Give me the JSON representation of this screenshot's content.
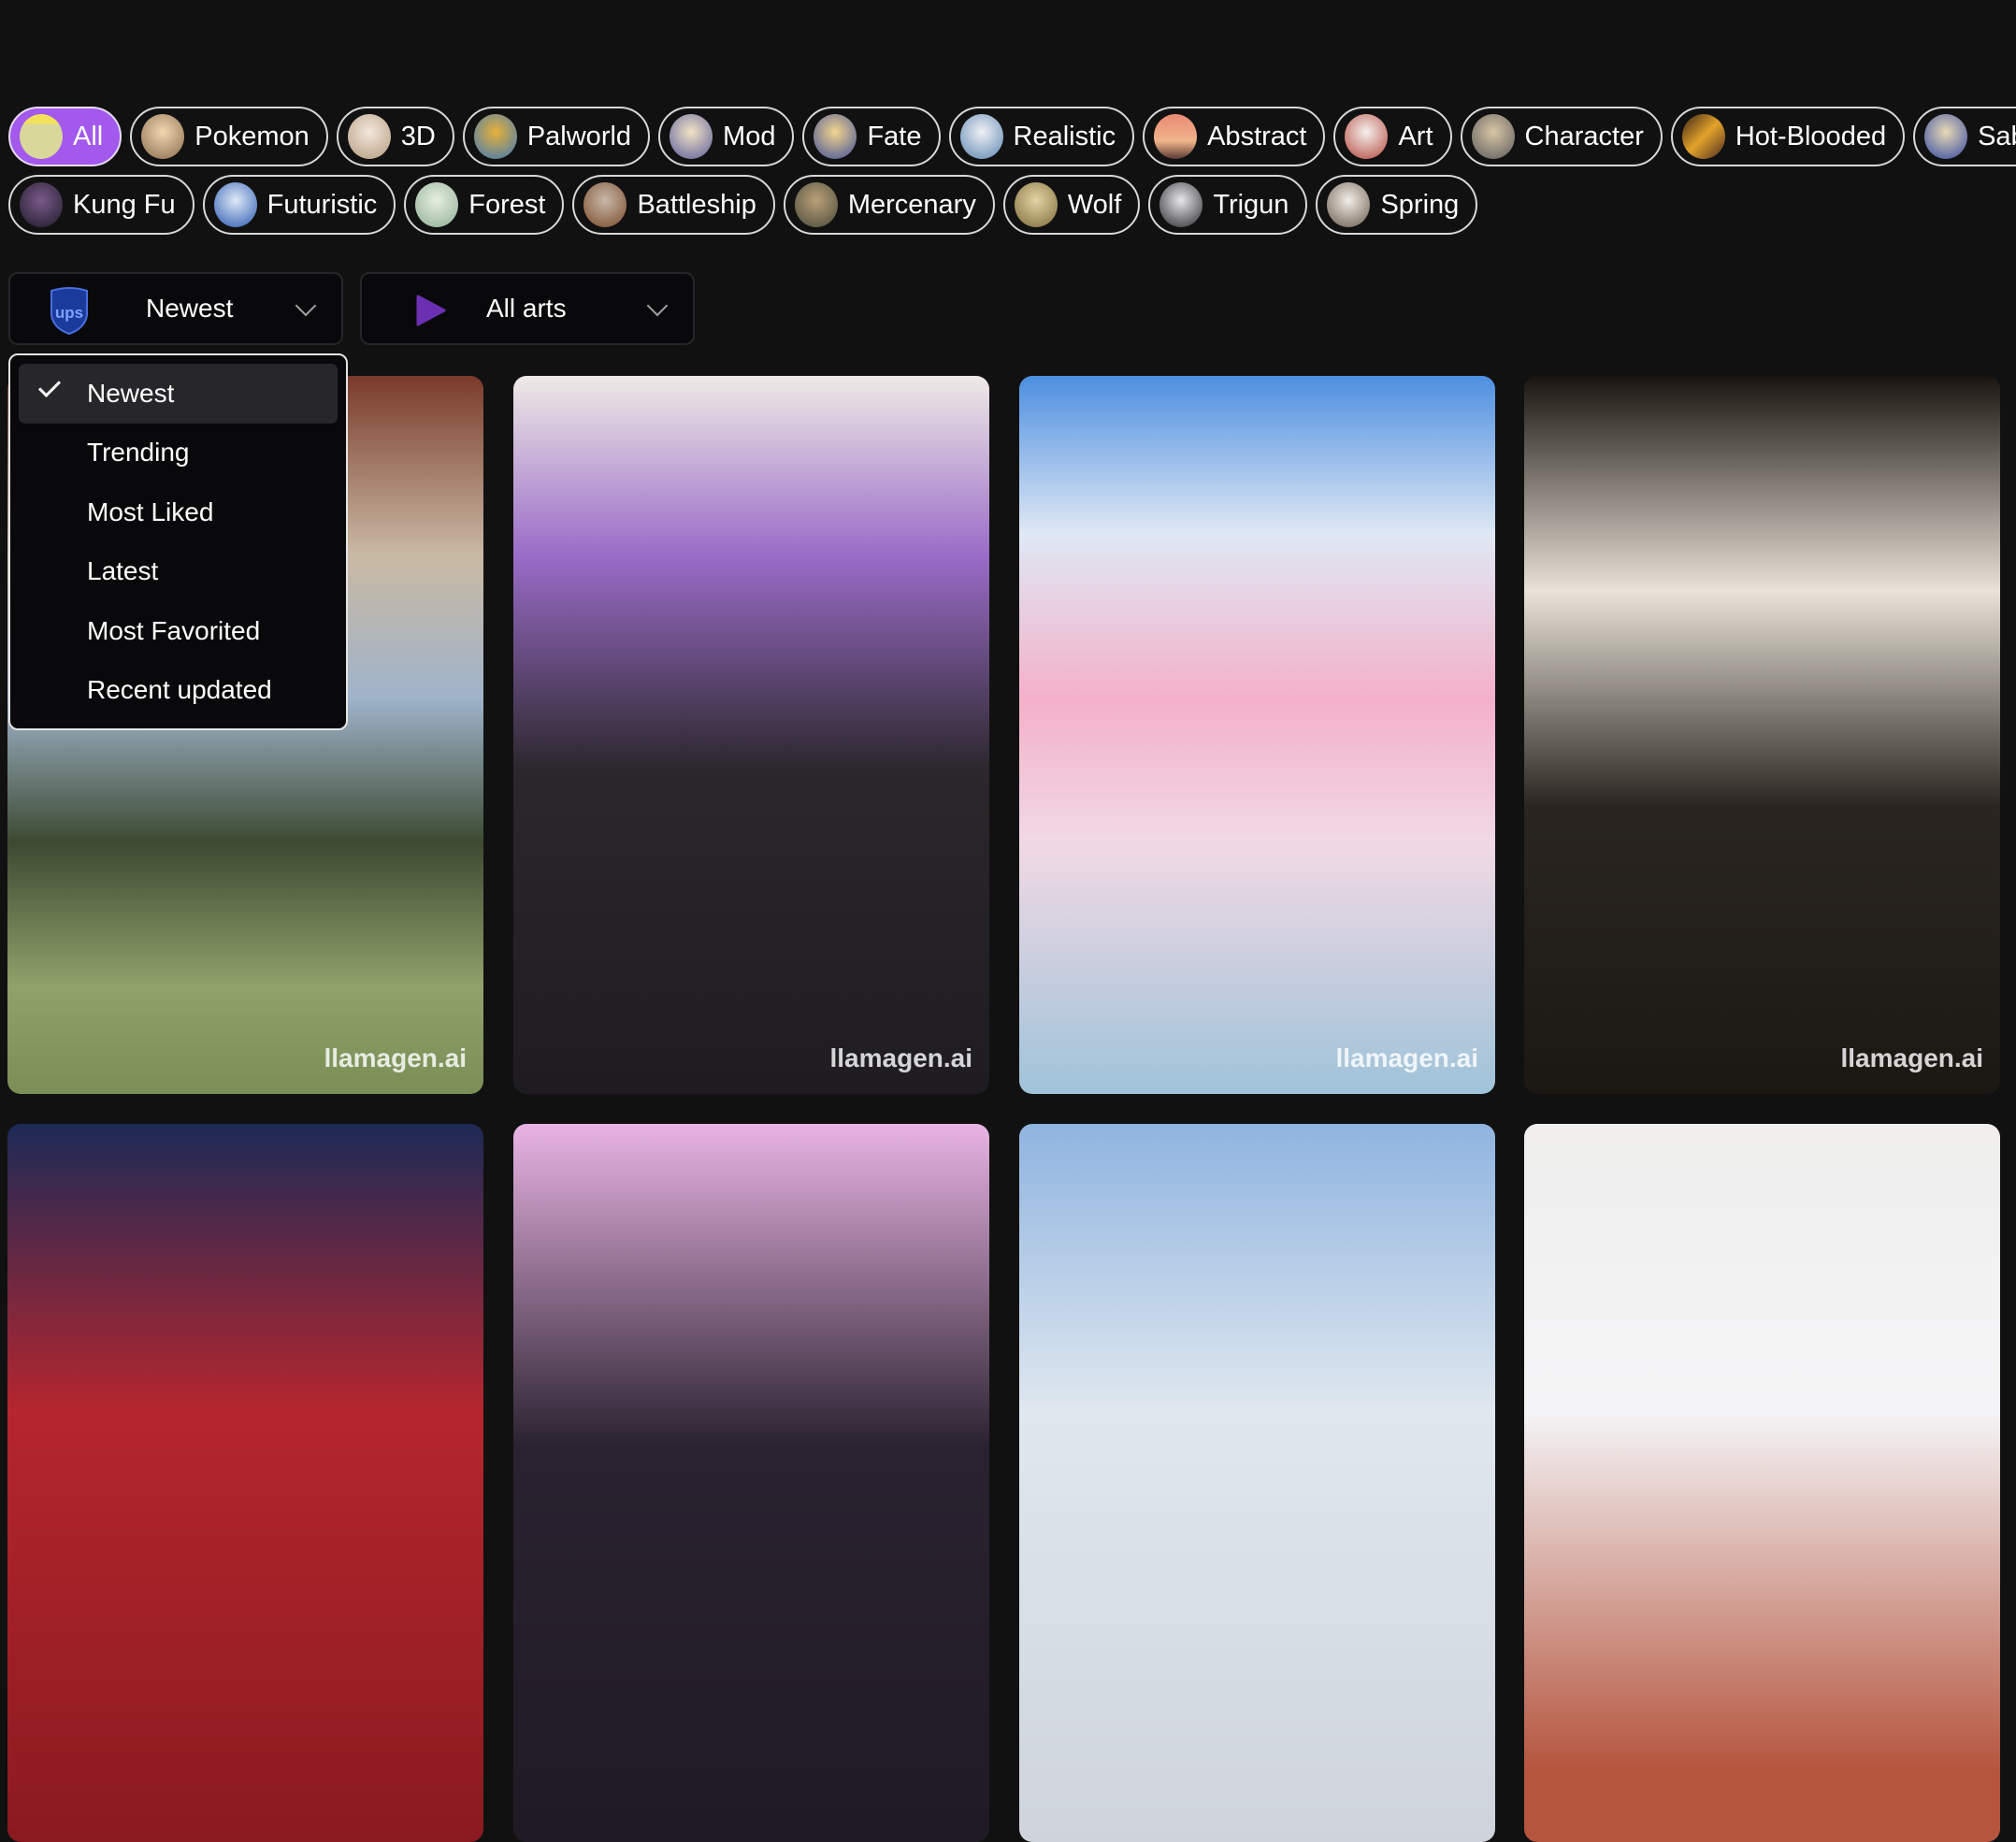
{
  "categories": {
    "row1": [
      {
        "label": "All",
        "active": true,
        "thumb": "linear-gradient(#f2e15a 0 22%, #d9d79a 22% 100%)"
      },
      {
        "label": "Pokemon",
        "thumb": "radial-gradient(circle at 50% 40%, #f1d8b0, #8a6b4f)"
      },
      {
        "label": "3D",
        "thumb": "radial-gradient(circle at 50% 40%, #f3e8dc, #b49a7e)"
      },
      {
        "label": "Palworld",
        "thumb": "radial-gradient(circle at 50% 40%, #e7b23a, #3b76b8)"
      },
      {
        "label": "Mod",
        "thumb": "radial-gradient(circle at 50% 40%, #f2e3c6, #5a5d9a)"
      },
      {
        "label": "Fate",
        "thumb": "radial-gradient(circle at 50% 40%, #f3d58d, #3f4f9a)"
      },
      {
        "label": "Realistic",
        "thumb": "radial-gradient(circle at 50% 40%, #f0f0f4, #5c86b2)"
      },
      {
        "label": "Abstract",
        "thumb": "linear-gradient(#e88a72, #f0b48c 60%, #5a3a32)"
      },
      {
        "label": "Art",
        "thumb": "radial-gradient(circle at 50% 40%, #f4f0ee, #b4483c)"
      },
      {
        "label": "Character",
        "thumb": "radial-gradient(circle at 50% 40%, #d9c6a6, #5a5a5a)"
      },
      {
        "label": "Hot-Blooded",
        "thumb": "linear-gradient(135deg,#3b2418,#e4a32a 50%,#4a2a20)"
      },
      {
        "label": "Saber",
        "thumb": "radial-gradient(circle at 50% 40%, #e9d9b6, #3148a0)"
      }
    ],
    "row2": [
      {
        "label": "Kung Fu",
        "thumb": "radial-gradient(circle at 50% 40%, #7a5a8a, #1e1a28)"
      },
      {
        "label": "Futuristic",
        "thumb": "radial-gradient(circle at 50% 40%, #dfe9f7, #2a58b0)"
      },
      {
        "label": "Forest",
        "thumb": "radial-gradient(circle at 50% 40%, #e6efe0, #8fae94)"
      },
      {
        "label": "Battleship",
        "thumb": "radial-gradient(circle at 50% 40%, #c8b8a8, #7a4a2a)"
      },
      {
        "label": "Mercenary",
        "thumb": "radial-gradient(circle at 50% 40%, #b9a07a, #4a4a3a)"
      },
      {
        "label": "Wolf",
        "thumb": "radial-gradient(circle at 50% 40%, #e4d3a4, #7c6a3a)"
      },
      {
        "label": "Trigun",
        "thumb": "radial-gradient(circle at 50% 40%, #e8e8ea, #2a2a2e)"
      },
      {
        "label": "Spring",
        "thumb": "radial-gradient(circle at 50% 40%, #f2eee8, #6a5a4a)"
      }
    ]
  },
  "sort_select": {
    "value": "Newest",
    "icon": "ups-shield-icon"
  },
  "type_select": {
    "value": "All arts",
    "icon": "play-triangle-icon"
  },
  "sort_menu": {
    "items": [
      {
        "label": "Newest",
        "selected": true
      },
      {
        "label": "Trending"
      },
      {
        "label": "Most Liked"
      },
      {
        "label": "Latest"
      },
      {
        "label": "Most Favorited"
      },
      {
        "label": "Recent updated"
      }
    ]
  },
  "gallery": {
    "watermark": "llamagen.ai",
    "cards": [
      {
        "bg": "linear-gradient(180deg,#7a3a2a 0%,#c9b9a4 25%,#9fb3c9 45%,#3c4a32 65%,#8fa26a 85%,#7a8e56 100%)"
      },
      {
        "bg": "linear-gradient(180deg,#efeae6 0%,#9a6cc8 25%,#2b272c 55%,#1e1c20 100%)"
      },
      {
        "bg": "linear-gradient(180deg,#4d8fe0 0%,#dfe8f4 22%,#f3b0c9 45%,#f1d9e4 65%,#9fc3d9 100%)"
      },
      {
        "bg": "linear-gradient(180deg,#1a1410 0%,#e8e2d8 30%,#2a2520 60%,#1b1814 100%)"
      },
      {
        "bg": "linear-gradient(180deg,#1c2a56 0%,#b5262e 40%,#8a1a1f 100%)"
      },
      {
        "bg": "linear-gradient(180deg,#e9b4e4 0%,#2a2230 45%,#1f1a24 100%)"
      },
      {
        "bg": "linear-gradient(180deg,#8fb4e0 0%,#dfe7ef 40%,#cfd4dc 100%)"
      },
      {
        "bg": "linear-gradient(180deg,#f0efee 0%,#f4f4f6 40%,#b5553e 90%)"
      }
    ],
    "show_watermark": [
      true,
      true,
      true,
      true,
      false,
      false,
      false,
      false
    ]
  }
}
